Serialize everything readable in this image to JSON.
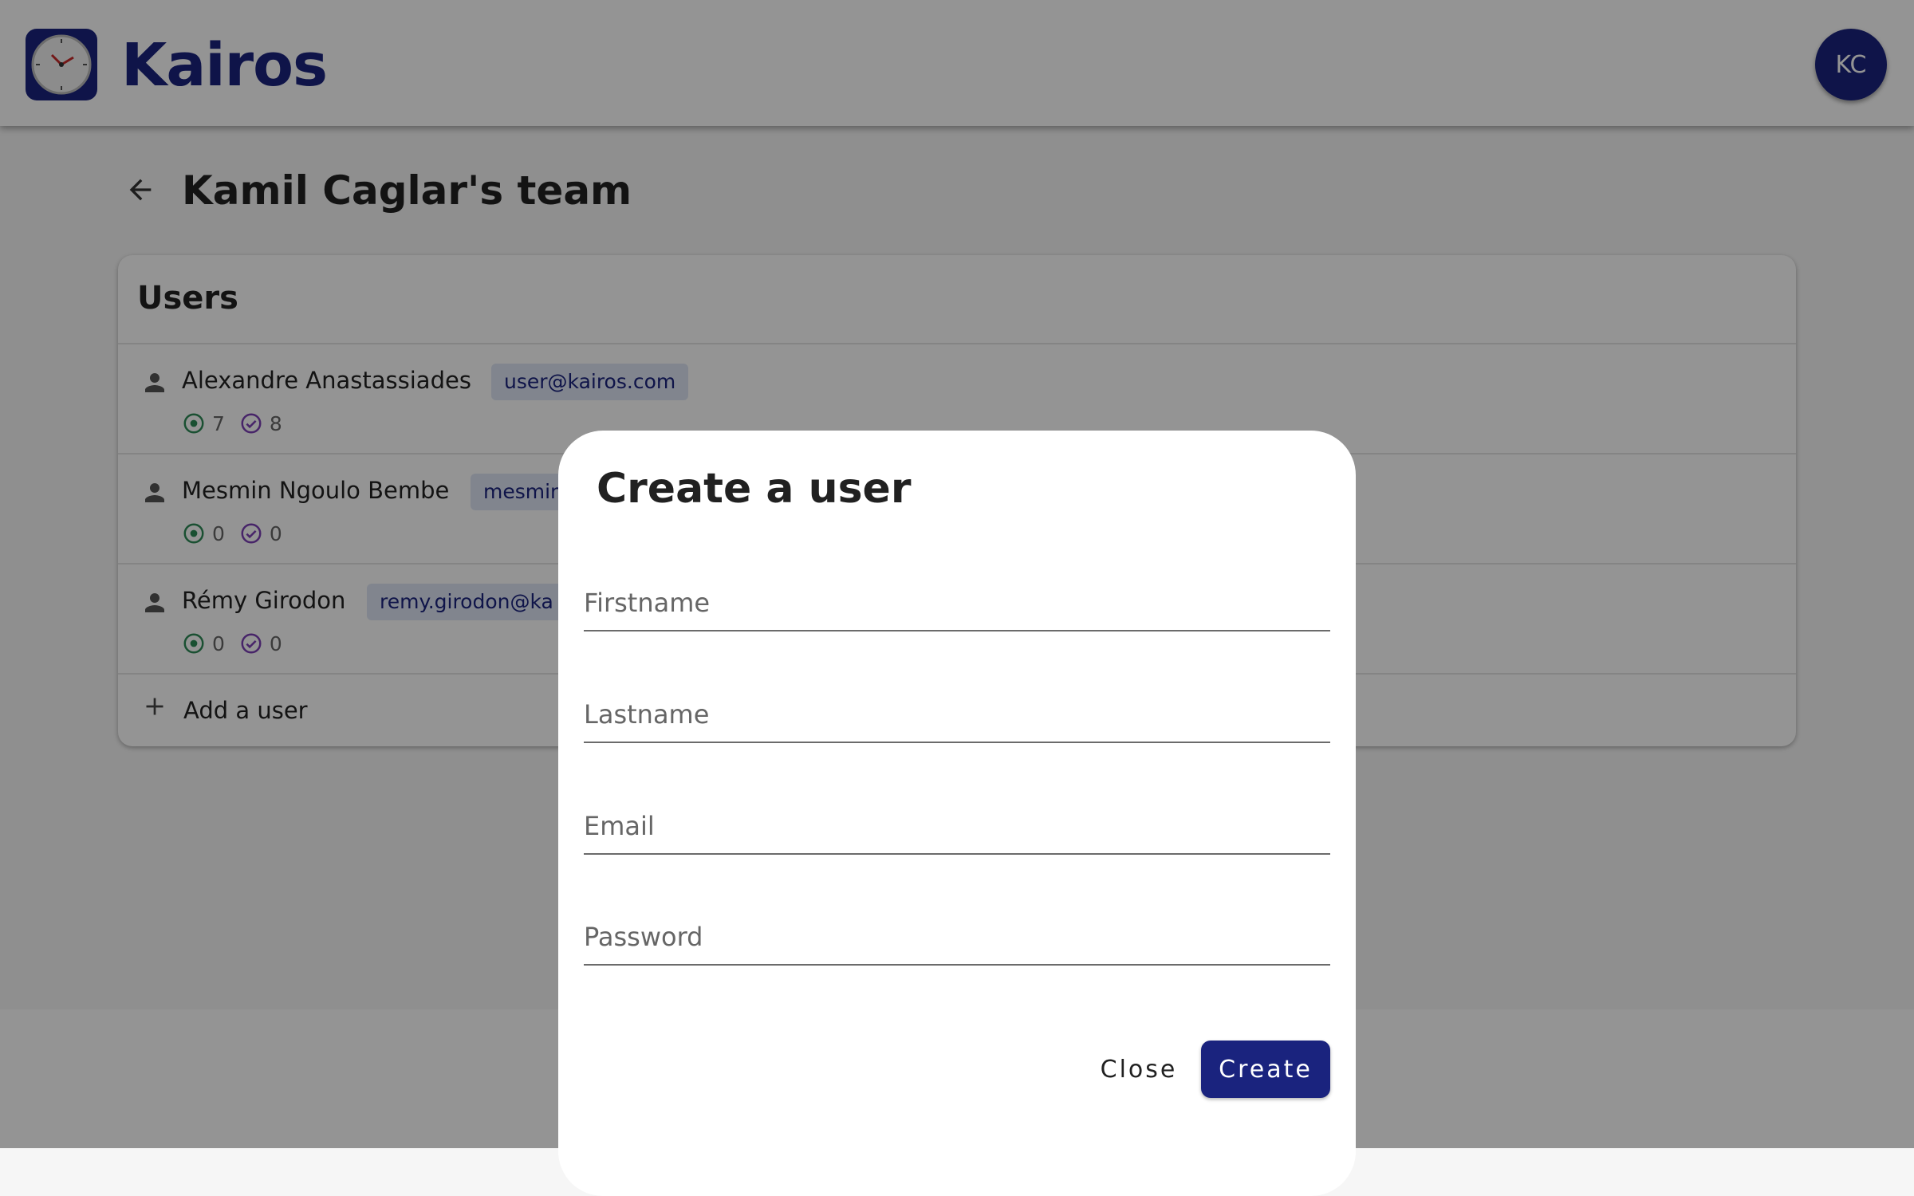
{
  "app": {
    "name": "Kairos",
    "avatar_initials": "KC",
    "brand_color": "#1a237e"
  },
  "page": {
    "title": "Kamil Caglar's team"
  },
  "users_card": {
    "title": "Users",
    "users": [
      {
        "name": "Alexandre Anastassiades",
        "email": "user@kairos.com",
        "active_count": "7",
        "done_count": "8"
      },
      {
        "name": "Mesmin Ngoulo Bembe",
        "email": "mesmin",
        "active_count": "0",
        "done_count": "0"
      },
      {
        "name": "Rémy Girodon",
        "email": "remy.girodon@ka",
        "active_count": "0",
        "done_count": "0"
      }
    ],
    "add_label": "Add a user"
  },
  "dialog": {
    "title": "Create a user",
    "fields": [
      {
        "placeholder": "Firstname",
        "value": ""
      },
      {
        "placeholder": "Lastname",
        "value": ""
      },
      {
        "placeholder": "Email",
        "value": ""
      },
      {
        "placeholder": "Password",
        "value": ""
      }
    ],
    "close_label": "Close",
    "create_label": "Create"
  },
  "icons": {
    "logo": "clock-icon",
    "back": "arrow-left-icon",
    "person": "person-icon",
    "active": "target-circle-icon",
    "done": "check-circle-icon",
    "add": "plus-icon"
  },
  "colors": {
    "active_icon": "#2e8b57",
    "done_icon": "#7b3fb5",
    "chip_bg": "#dfe6f4"
  }
}
